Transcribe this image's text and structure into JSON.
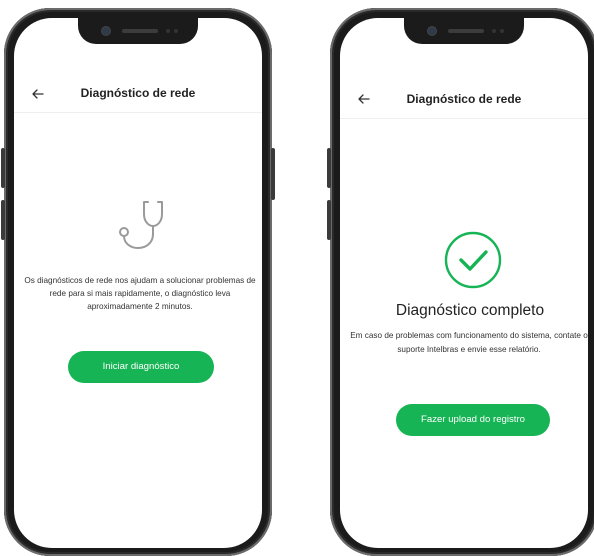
{
  "screens": [
    {
      "title": "Diagnóstico de rede",
      "icon": "stethoscope-icon",
      "description": "Os diagnósticos de rede nos ajudam a solucionar problemas de rede para si mais rapidamente, o diagnóstico leva aproximadamente 2 minutos.",
      "button": "Iniciar diagnóstico"
    },
    {
      "title": "Diagnóstico de rede",
      "icon": "check-circle-icon",
      "heading": "Diagnóstico completo",
      "description": "Em caso de problemas com funcionamento do sistema, contate o suporte Intelbras e envie esse relatório.",
      "button": "Fazer upload do registro"
    }
  ],
  "colors": {
    "accent": "#17b455",
    "frame": "#1b1b1b",
    "text": "#222222"
  }
}
